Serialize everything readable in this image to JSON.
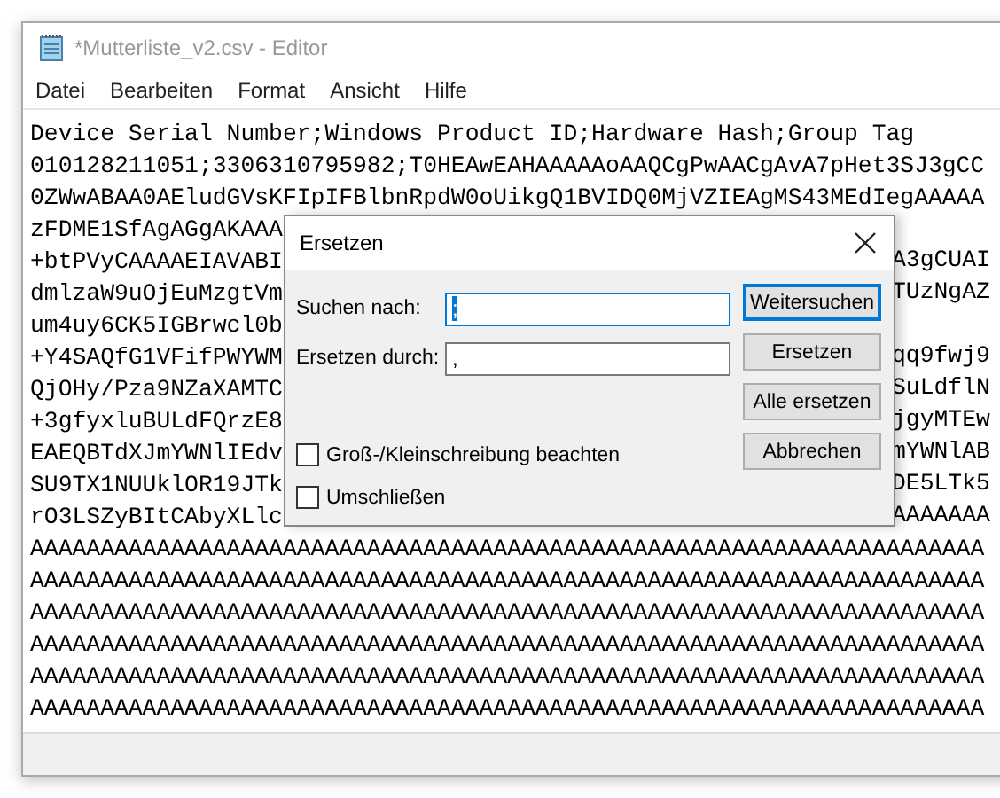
{
  "window": {
    "title": "*Mutterliste_v2.csv - Editor"
  },
  "menu": [
    "Datei",
    "Bearbeiten",
    "Format",
    "Ansicht",
    "Hilfe"
  ],
  "lines": [
    {
      "left": "Device Serial Number;Windows Product ID;Hardware Hash;Group Tag"
    },
    {
      "left": "010128211051;3306310795982;T0HEAwEAHAAAAAoAAQCgPwAACgAvA7pHet3SJ3gCC"
    },
    {
      "left": "0ZWwABAA0AEludGVsKFIpIFBlbnRpdW0oUikgQ1BVIDQ0MjVZIEAgMS43MEdIegAAAAA"
    },
    {
      "left": "zFDME1SfAgAGgAKAAA"
    },
    {
      "left": "+btPVyCAAAAEIAVABI",
      "right": "A3gCUAI"
    },
    {
      "left": "dmlzaW9uOjEuMzgtVm",
      "right": "TUzNgAZ"
    },
    {
      "left": "um4uy6CK5IGBrwcl0b"
    },
    {
      "left": "+Y4SAQfG1VFifPWYWM",
      "right": "qq9fwj9"
    },
    {
      "left": "QjOHy/Pza9NZaXAMTC",
      "right": "SuLdflN"
    },
    {
      "left": "+3gfyxluBULdFQrzE8",
      "right": "jgyMTEw"
    },
    {
      "left": "EAEQBTdXJmYWNlIEdv",
      "right": "mYWNlAB"
    },
    {
      "left": "SU9TX1NUUklOR19JTk",
      "right": "DE5LTk5"
    },
    {
      "left": "rO3LSZyBItCAbyXLlc",
      "right": "AAAAAAA"
    },
    {
      "left": "AAAAAAAAAAAAAAAAAAAAAAAAAAAAAAAAAAAAAAAAAAAAAAAAAAAAAAAAAAAAAAAAAAAA"
    },
    {
      "left": "AAAAAAAAAAAAAAAAAAAAAAAAAAAAAAAAAAAAAAAAAAAAAAAAAAAAAAAAAAAAAAAAAAAA"
    },
    {
      "left": "AAAAAAAAAAAAAAAAAAAAAAAAAAAAAAAAAAAAAAAAAAAAAAAAAAAAAAAAAAAAAAAAAAAA"
    },
    {
      "left": "AAAAAAAAAAAAAAAAAAAAAAAAAAAAAAAAAAAAAAAAAAAAAAAAAAAAAAAAAAAAAAAAAAAA"
    },
    {
      "left": "AAAAAAAAAAAAAAAAAAAAAAAAAAAAAAAAAAAAAAAAAAAAAAAAAAAAAAAAAAAAAAAAAAAA"
    },
    {
      "left": "AAAAAAAAAAAAAAAAAAAAAAAAAAAAAAAAAAAAAAAAAAAAAAAAAAAAAAAAAAAAAAAAAAAA"
    }
  ],
  "dialog": {
    "title": "Ersetzen",
    "fields": [
      {
        "label": "Suchen nach:",
        "value": ";",
        "focused": true
      },
      {
        "label": "Ersetzen durch:",
        "value": ",",
        "focused": false
      }
    ],
    "buttons": [
      {
        "label": "Weitersuchen",
        "default": true
      },
      {
        "label": "Ersetzen",
        "default": false
      },
      {
        "label": "Alle ersetzen",
        "default": false
      },
      {
        "label": "Abbrechen",
        "default": false
      }
    ],
    "checkboxes": [
      {
        "label": "Groß-/Kleinschreibung beachten",
        "checked": false
      },
      {
        "label": "Umschließen",
        "checked": false
      }
    ]
  }
}
